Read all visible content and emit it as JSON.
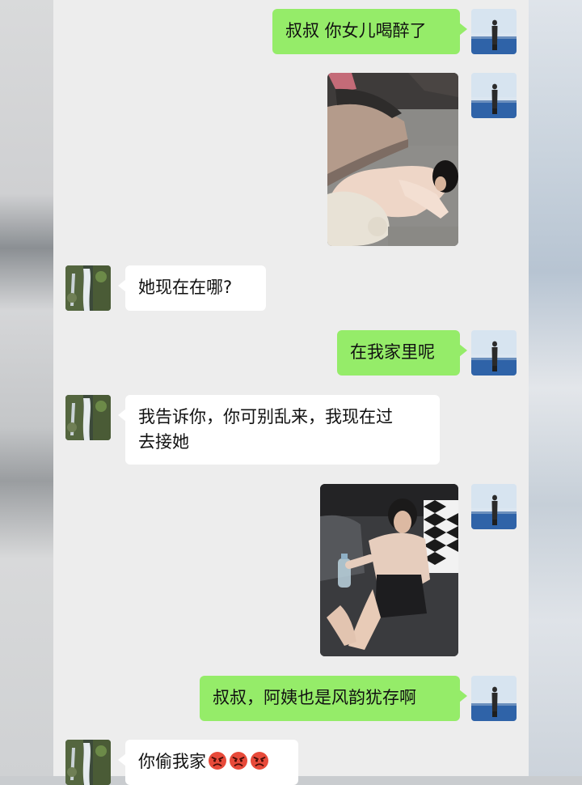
{
  "messages": [
    {
      "side": "right",
      "type": "text",
      "text": "叔叔 你女儿喝醉了"
    },
    {
      "side": "right",
      "type": "image",
      "alt": ""
    },
    {
      "side": "left",
      "type": "text",
      "text": "她现在在哪?"
    },
    {
      "side": "right",
      "type": "text",
      "text": "在我家里呢"
    },
    {
      "side": "left",
      "type": "text",
      "line1": "我告诉你，你可别乱来，我现在过",
      "line2": "去接她"
    },
    {
      "side": "right",
      "type": "image",
      "alt": ""
    },
    {
      "side": "right",
      "type": "text",
      "text": "叔叔，阿姨也是风韵犹存啊"
    },
    {
      "side": "left",
      "type": "text",
      "text": "你偷我家",
      "emoji": [
        "angry-face-icon",
        "angry-face-icon",
        "angry-face-icon"
      ]
    }
  ],
  "colors": {
    "outgoing_bubble": "#95ec69",
    "incoming_bubble": "#ffffff",
    "chat_background": "#ededed"
  },
  "icons": {
    "self_avatar": "sea-person-avatar",
    "contact_avatar": "waterfall-avatar"
  }
}
